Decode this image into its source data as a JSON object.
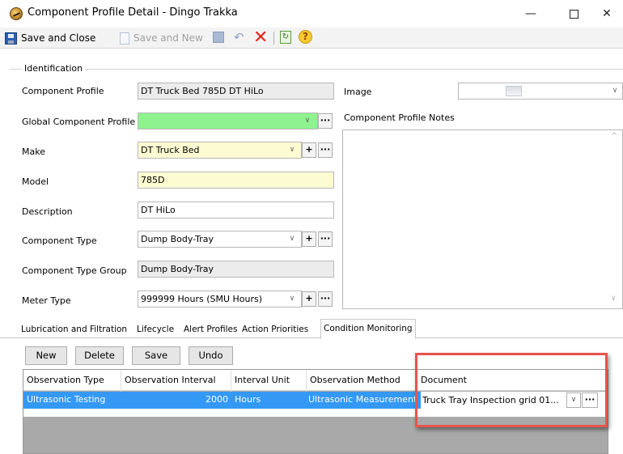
{
  "window": {
    "title": "Component Profile Detail - Dingo Trakka",
    "minimize_glyph": "—",
    "close_glyph": "✕"
  },
  "toolbar": {
    "save_close_label": "Save and Close",
    "save_new_label": "Save and New",
    "icons": [
      "floppy-disk-icon",
      "new-page-icon",
      "save-icon",
      "undo-icon",
      "delete-icon",
      "refresh-icon",
      "help-icon"
    ]
  },
  "identification": {
    "group_label": "Identification",
    "component_profile": {
      "label": "Component Profile",
      "value": "DT Truck Bed 785D DT HiLo"
    },
    "global_component_profile": {
      "label": "Global Component Profile",
      "value": ""
    },
    "make": {
      "label": "Make",
      "value": "DT Truck Bed"
    },
    "model": {
      "label": "Model",
      "value": "785D"
    },
    "description": {
      "label": "Description",
      "value": "DT HiLo"
    },
    "component_type": {
      "label": "Component Type",
      "value": "Dump Body-Tray"
    },
    "component_type_group": {
      "label": "Component Type Group",
      "value": "Dump Body-Tray"
    },
    "meter_type": {
      "label": "Meter Type",
      "value": "999999 Hours (SMU Hours)"
    },
    "image_label": "Image",
    "notes_label": "Component Profile Notes"
  },
  "glyphs": {
    "dropdown": "∨",
    "ellipsis": "···",
    "add": "+",
    "scroll_up": "^",
    "scroll_down": "∨"
  },
  "tabs": [
    {
      "label": "Lubrication and Filtration",
      "active": false
    },
    {
      "label": "Lifecycle",
      "active": false
    },
    {
      "label": "Alert Profiles",
      "active": false
    },
    {
      "label": "Action Priorities",
      "active": false
    },
    {
      "label": "Condition Monitoring",
      "active": true
    }
  ],
  "grid_buttons": {
    "new": "New",
    "delete": "Delete",
    "save": "Save",
    "undo": "Undo"
  },
  "grid": {
    "columns": [
      "Observation Type",
      "Observation Interval",
      "Interval Unit",
      "Observation Method",
      "Document"
    ],
    "rows": [
      {
        "observation_type": "Ultrasonic Testing",
        "observation_interval": "2000",
        "interval_unit": "Hours",
        "observation_method": "Ultrasonic Measurement",
        "document": "Truck Tray Inspection grid 01..."
      }
    ]
  },
  "colors": {
    "selected_row": "#3498f5",
    "highlight_border": "#e8544c",
    "required_field": "#fdfbd2",
    "global_profile_field": "#8ef28e"
  }
}
